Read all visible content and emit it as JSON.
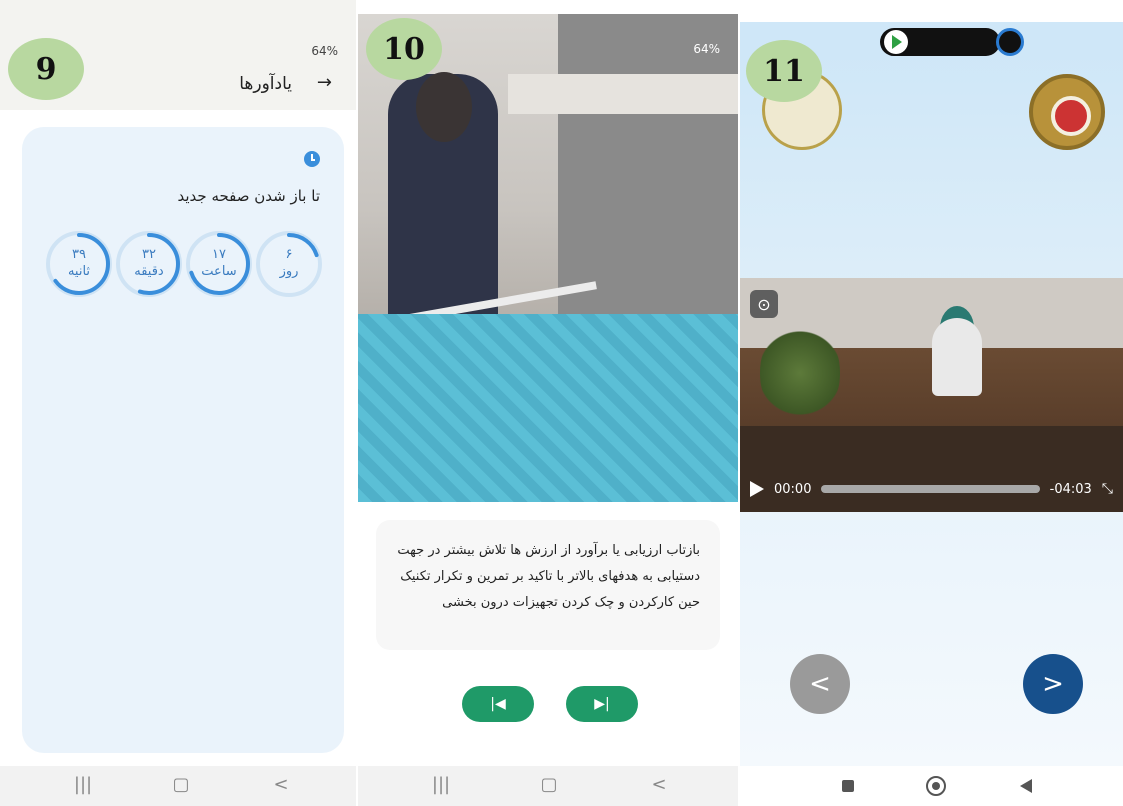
{
  "panel9": {
    "badge": "9",
    "status_text": "64%",
    "appbar_title": "یادآورها",
    "back_icon": "→",
    "card_title": "تا باز شدن صفحه جدید",
    "countdown": [
      {
        "value": "۶",
        "label": "روز",
        "fraction": 0.2
      },
      {
        "value": "۱۷",
        "label": "ساعت",
        "fraction": 0.7
      },
      {
        "value": "۳۲",
        "label": "دقیقه",
        "fraction": 0.55
      },
      {
        "value": "۳۹",
        "label": "ثانیه",
        "fraction": 0.65
      }
    ],
    "nav": {
      "recent": "|||",
      "home": "▢",
      "back": "<"
    }
  },
  "panel10": {
    "badge": "10",
    "status_text": "64%",
    "body_text": "بازتاب ارزیابی یا برآورد از ارزش ها تلاش بیشتر در جهت دستیابی به هدفهای بالاتر با تاکید بر تمرین و تکرار تکنیک حین کارکردن و چک کردن تجهیزات درون بخشی",
    "prev_label": "|◀",
    "next_label": "▶|",
    "nav": {
      "recent": "|||",
      "home": "▢",
      "back": "<"
    }
  },
  "panel11": {
    "badge": "11",
    "time_current": "00:00",
    "time_remaining": "-04:03",
    "expand_glyph": "⤡",
    "prev_glyph": "<",
    "next_glyph": ">"
  },
  "colors": {
    "badge_green": "#b8d8a0",
    "accent_blue": "#3a8edb",
    "pill_green": "#1f9a68",
    "next_blue": "#17508c"
  }
}
